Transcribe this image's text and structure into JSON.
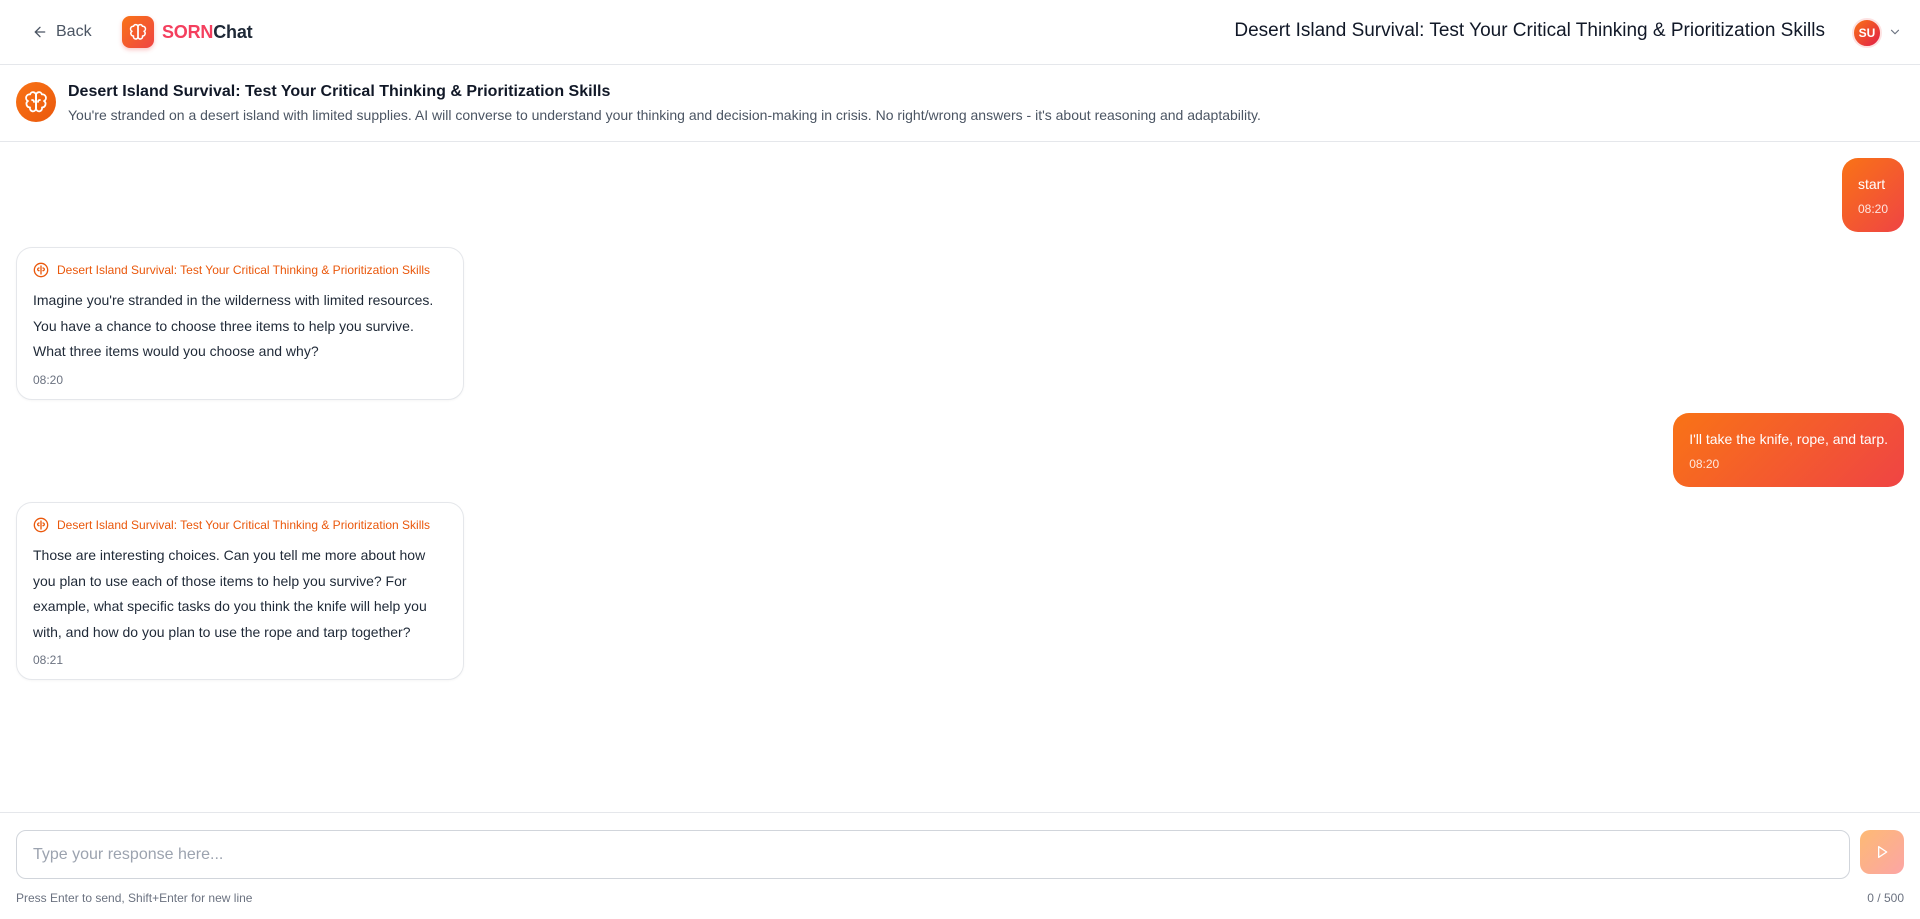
{
  "topbar": {
    "back_label": "Back",
    "brand_part1": "SORN",
    "brand_part2": "Chat",
    "title": "Desert Island Survival: Test Your Critical Thinking & Prioritization Skills",
    "avatar_initials": "SU"
  },
  "chat_header": {
    "title": "Desert Island Survival: Test Your Critical Thinking & Prioritization Skills",
    "description": "You're stranded on a desert island with limited supplies. AI will converse to understand your thinking and decision-making in crisis. No right/wrong answers - it's about reasoning and adaptability."
  },
  "messages": [
    {
      "role": "user",
      "text": "start",
      "time": "08:20"
    },
    {
      "role": "assistant",
      "sender": "Desert Island Survival: Test Your Critical Thinking & Prioritization Skills",
      "text": "Imagine you're stranded in the wilderness with limited resources. You have a chance to choose three items to help you survive. What three items would you choose and why?",
      "time": "08:20"
    },
    {
      "role": "user",
      "text": "I'll take the knife, rope, and tarp.",
      "time": "08:20"
    },
    {
      "role": "assistant",
      "sender": "Desert Island Survival: Test Your Critical Thinking & Prioritization Skills",
      "text": "Those are interesting choices. Can you tell me more about how you plan to use each of those items to help you survive? For example, what specific tasks do you think the knife will help you with, and how do you plan to use the rope and tarp together?",
      "time": "08:21"
    }
  ],
  "composer": {
    "placeholder": "Type your response here...",
    "value": "",
    "hint": "Press Enter to send, Shift+Enter for new line",
    "counter": "0 / 500"
  },
  "colors": {
    "accent_start": "#f97316",
    "accent_end": "#ef4444",
    "brand_highlight": "#f43f5e",
    "assistant_label": "#ea580c"
  }
}
